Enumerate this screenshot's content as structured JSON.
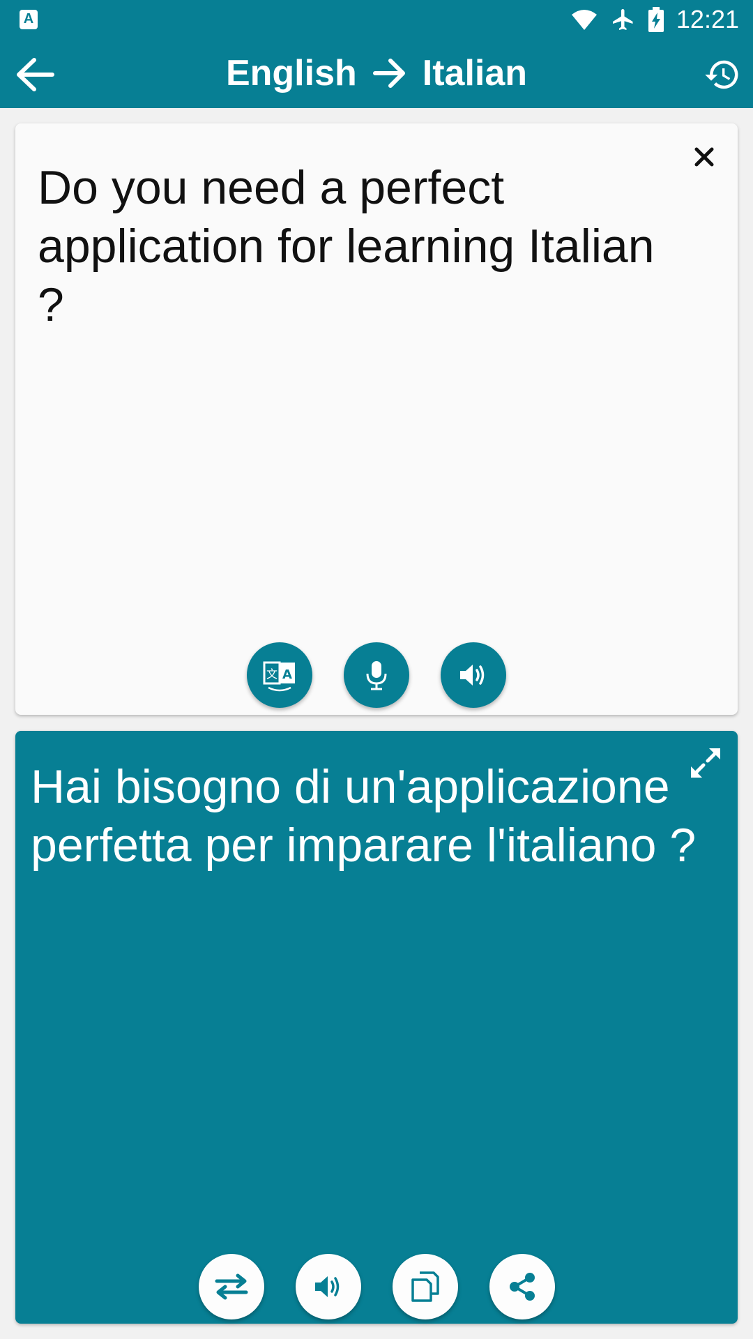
{
  "status_bar": {
    "app_icon": "translate-app-icon",
    "icons": [
      "wifi-icon",
      "airplane-icon",
      "battery-charging-icon"
    ],
    "time": "12:21",
    "icon_letter": "A"
  },
  "app_bar": {
    "source_language": "English",
    "target_language": "Italian",
    "back_icon": "arrow-left-icon",
    "arrow_icon": "arrow-right-icon",
    "history_icon": "history-icon"
  },
  "source": {
    "text": "Do you need a perfect application for learning Italian ?",
    "clear_icon": "close-icon",
    "actions": [
      "translate-icon",
      "microphone-icon",
      "speaker-icon"
    ]
  },
  "target": {
    "text": "Hai bisogno di un'applicazione perfetta per imparare l'italiano ?",
    "expand_icon": "expand-icon",
    "actions": [
      "swap-icon",
      "speaker-icon",
      "copy-icon",
      "share-icon"
    ]
  },
  "colors": {
    "primary": "#077f94",
    "surface": "#fafafa",
    "background": "#f1f1f1"
  }
}
